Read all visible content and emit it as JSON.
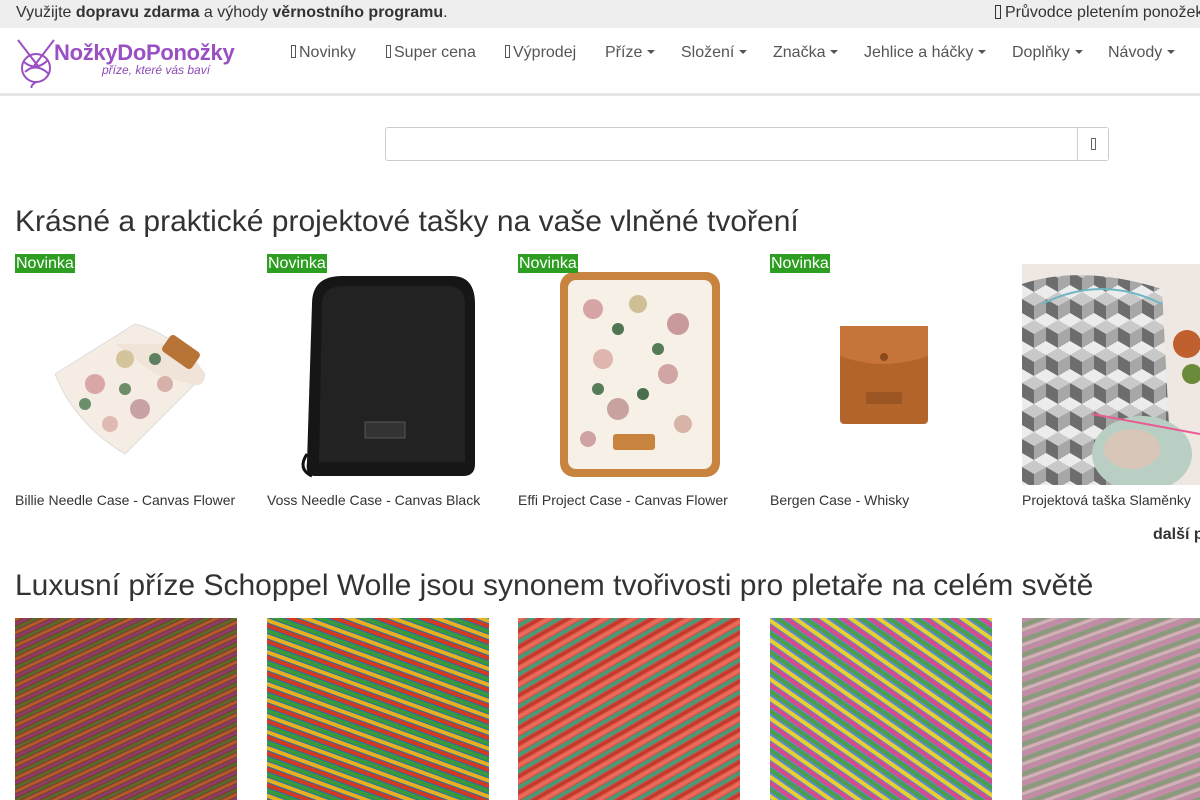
{
  "topbar": {
    "promo_prefix": "Využijte ",
    "promo_bold1": "dopravu zdarma",
    "promo_mid": " a výhody ",
    "promo_bold2": "věrnostního programu",
    "promo_suffix": ".",
    "guide_label": "Průvodce pletením ponožek"
  },
  "logo": {
    "name": "NožkyDoPonožky",
    "tagline": "příze, které vás baví"
  },
  "nav": {
    "novinky": "Novinky",
    "super_cena": "Super cena",
    "vyprodej": "Výprodej",
    "prize": "Příze",
    "slozeni": "Složení",
    "znacka": "Značka",
    "jehlice": "Jehlice a háčky",
    "doplnky": "Doplňky",
    "navody": "Návody"
  },
  "search": {
    "placeholder": "",
    "value": "",
    "icon": "search-icon"
  },
  "sections": {
    "bags_title": "Krásné a praktické projektové tašky na vaše vlněné tvoření",
    "yarn_title": "Luxusní příze Schoppel Wolle jsou synonem tvořivosti pro pletaře na celém světě",
    "more_link": "další p"
  },
  "products": [
    {
      "badge": "Novinka",
      "name": "Billie Needle Case - Canvas Flower"
    },
    {
      "badge": "Novinka",
      "name": "Voss Needle Case - Canvas Black"
    },
    {
      "badge": "Novinka",
      "name": "Effi Project Case - Canvas Flower"
    },
    {
      "badge": "Novinka",
      "name": "Bergen Case - Whisky"
    },
    {
      "badge": "",
      "name": "Projektová taška Slaměnky"
    }
  ],
  "colors": {
    "accent": "#9a4fc2",
    "badge": "#2e9e22",
    "topbar": "#eeeeee"
  }
}
